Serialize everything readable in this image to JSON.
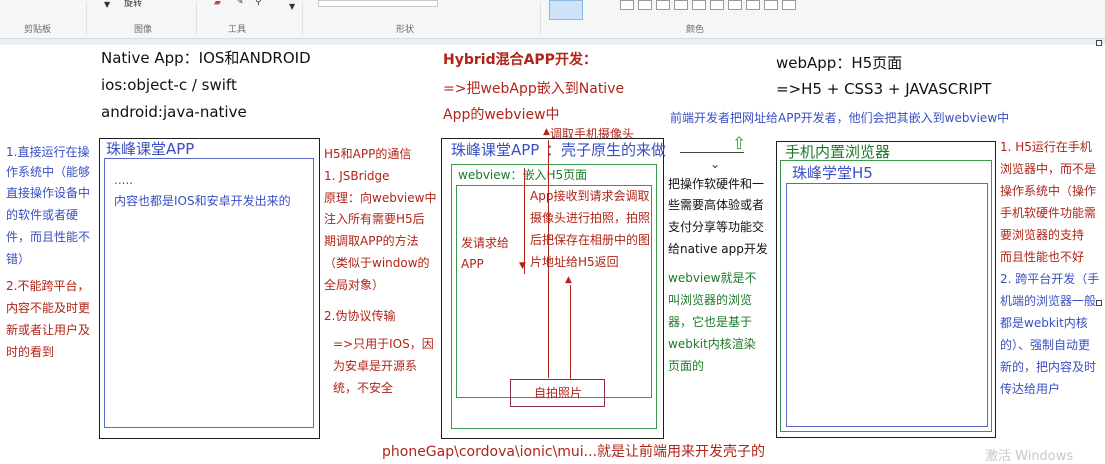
{
  "ribbon": {
    "groups": [
      "剪贴板",
      "图像",
      "工具",
      "形状",
      "颜色"
    ],
    "rotate_label": "旋转"
  },
  "col1": {
    "title_lines": [
      "Native App：IOS和ANDROID",
      "ios:object-c / swift",
      "android:java-native"
    ],
    "box_title": "珠峰课堂APP",
    "box_dots": ".....",
    "box_text": "内容也都是IOS和安卓开发出来的",
    "left_notes_1": [
      "1.直接运行在操",
      "作系统中（能够",
      "直接操作设备中",
      "的软件或者硬",
      "件，而且性能不",
      "错）"
    ],
    "left_notes_2": [
      "2.不能跨平台，",
      "内容不能及时更",
      "新或者让用户及",
      "时的看到"
    ]
  },
  "col2": {
    "notes_1": [
      "H5和APP的通信",
      "1. JSBridge",
      "原理：向webview中",
      "注入所有需要H5后",
      "期调取APP的方法",
      "（类似于window的",
      "全局对象）"
    ],
    "notes_2": "2.伪协议传输",
    "notes_3": [
      "=>只用于IOS，因",
      "为安卓是开源系",
      "统，不安全"
    ]
  },
  "col3": {
    "title": "Hybrid混合APP开发：",
    "subtitle_lines": [
      "=>把webApp嵌入到Native",
      "App的webview中"
    ],
    "top_note": "调取手机摄像头",
    "box_title": "珠峰课堂APP",
    "shell_note": "：壳子原生的来做",
    "webview_label": "webview：嵌入H5页面",
    "request_lines": [
      "发请求给",
      "APP"
    ],
    "app_lines": [
      "App接收到请求会调取",
      "摄像头进行拍照，拍照",
      "后把保存在相册中的图",
      "片地址给H5返回"
    ],
    "selfie": "自拍照片"
  },
  "col4": {
    "note_top": "前端开发者把网址给APP开发者，他们会把其嵌入到webview中",
    "note_mid": [
      "把操作软硬件和一",
      "些需要高体验或者",
      "支付分享等功能交",
      "给native app开发"
    ],
    "note_green": [
      "webview就是不",
      "叫浏览器的浏览",
      "器，它也是基于",
      "webkit内核渲染",
      "页面的"
    ]
  },
  "col5": {
    "title_lines": [
      "webApp：H5页面",
      "=>H5 + CSS3 + JAVASCRIPT"
    ],
    "box_title": "手机内置浏览器",
    "inner_title": "珠峰学堂H5",
    "right_notes_1": [
      "1. H5运行在手机",
      "浏览器中，而不是",
      "操作系统中（操作",
      "手机软硬件功能需",
      "要浏览器的支持",
      "而且性能也不好"
    ],
    "right_notes_2": [
      "2. 跨平台开发（手",
      "机端的浏览器一般",
      "都是webkit内核",
      "的）、强制自动更",
      "新的，把内容及时",
      "传达给用户"
    ]
  },
  "footer": "phoneGap\\cordova\\ionic\\mui...就是让前端用来开发壳子的",
  "watermark": "激活 Windows"
}
